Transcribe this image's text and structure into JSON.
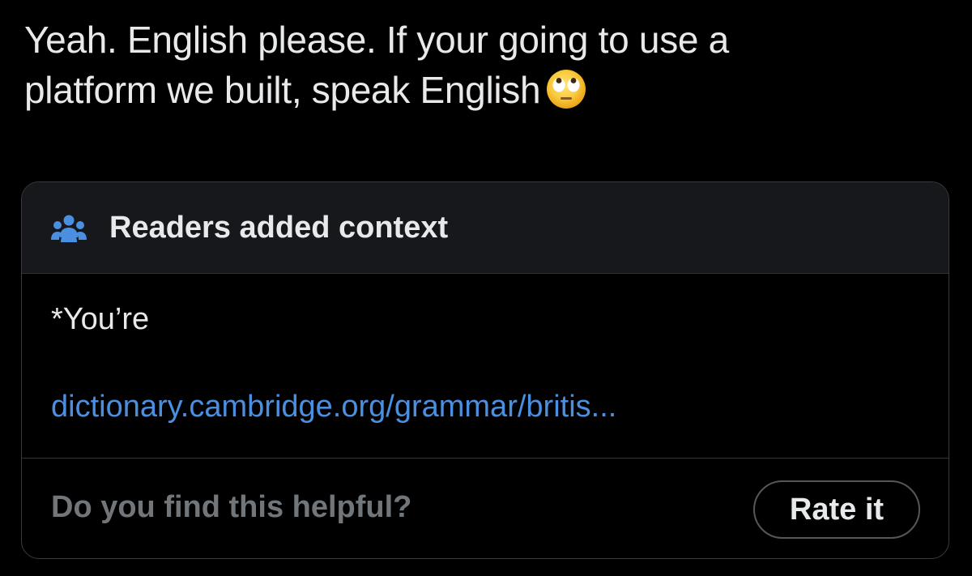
{
  "tweet": {
    "text_line1": "Yeah. English please. If your going to use a",
    "text_line2": "platform we built, speak English",
    "emoji": "face-with-rolling-eyes"
  },
  "community_note": {
    "header_icon": "people-icon",
    "title": "Readers added context",
    "body_text": "*You’re",
    "link_text": "dictionary.cambridge.org/grammar/britis...",
    "helpful_question": "Do you find this helpful?",
    "rate_button_label": "Rate it"
  },
  "colors": {
    "background": "#000000",
    "text": "#e7e9ea",
    "link": "#4a8fe0",
    "muted": "#71767b",
    "icon_accent": "#4a8fe0",
    "header_bg": "#16181c"
  }
}
